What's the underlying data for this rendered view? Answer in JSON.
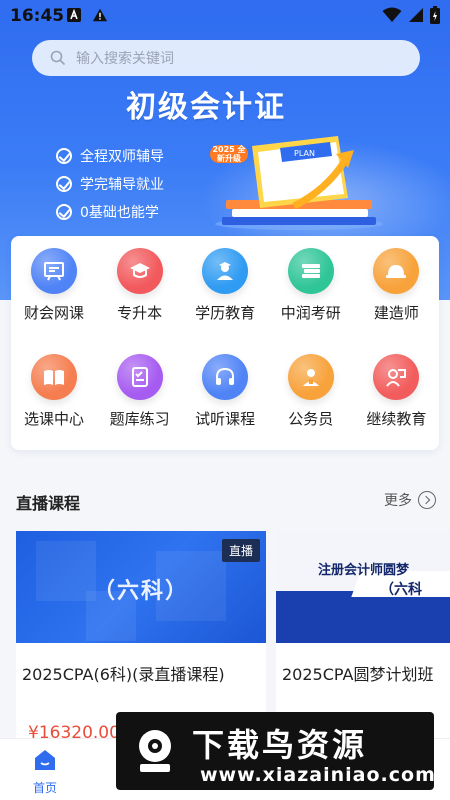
{
  "status_bar": {
    "time": "16:45"
  },
  "search": {
    "placeholder": "输入搜索关键词"
  },
  "banner": {
    "title": "初级会计证",
    "features": [
      "全程双师辅导",
      "学完辅导就业",
      "0基础也能学"
    ],
    "badge": "2025 全新升级",
    "calendar_label": "PLAN"
  },
  "categories": [
    {
      "label": "财会网课",
      "icon": "blackboard-icon",
      "color": "#4f83f6"
    },
    {
      "label": "专升本",
      "icon": "graduation-cap-icon",
      "color": "#f2595c"
    },
    {
      "label": "学历教育",
      "icon": "student-icon",
      "color": "#2f9bf2"
    },
    {
      "label": "中润考研",
      "icon": "books-icon",
      "color": "#2fc597"
    },
    {
      "label": "建造师",
      "icon": "helmet-icon",
      "color": "#f7a23a"
    },
    {
      "label": "选课中心",
      "icon": "open-book-icon",
      "color": "#f57d4f"
    },
    {
      "label": "题库练习",
      "icon": "checklist-icon",
      "color": "#a65cf0"
    },
    {
      "label": "试听课程",
      "icon": "headphones-icon",
      "color": "#4f83f6"
    },
    {
      "label": "公务员",
      "icon": "civil-servant-icon",
      "color": "#f7a23a"
    },
    {
      "label": "继续教育",
      "icon": "lecture-icon",
      "color": "#f25c5c"
    }
  ],
  "live": {
    "title": "直播课程",
    "more": "更多",
    "courses": [
      {
        "thumb_title": "（六科）",
        "tag": "直播",
        "name": "2025CPA(6科)(录直播课程)",
        "price": "¥16320.00"
      },
      {
        "thumb_line1": "注册会计师圆梦",
        "thumb_line2": "（六科",
        "name": "2025CPA圆梦计划班"
      }
    ]
  },
  "nav": {
    "home": "首页"
  },
  "watermark": {
    "title": "下载鸟资源",
    "url": "www.xiazainiao.com"
  }
}
